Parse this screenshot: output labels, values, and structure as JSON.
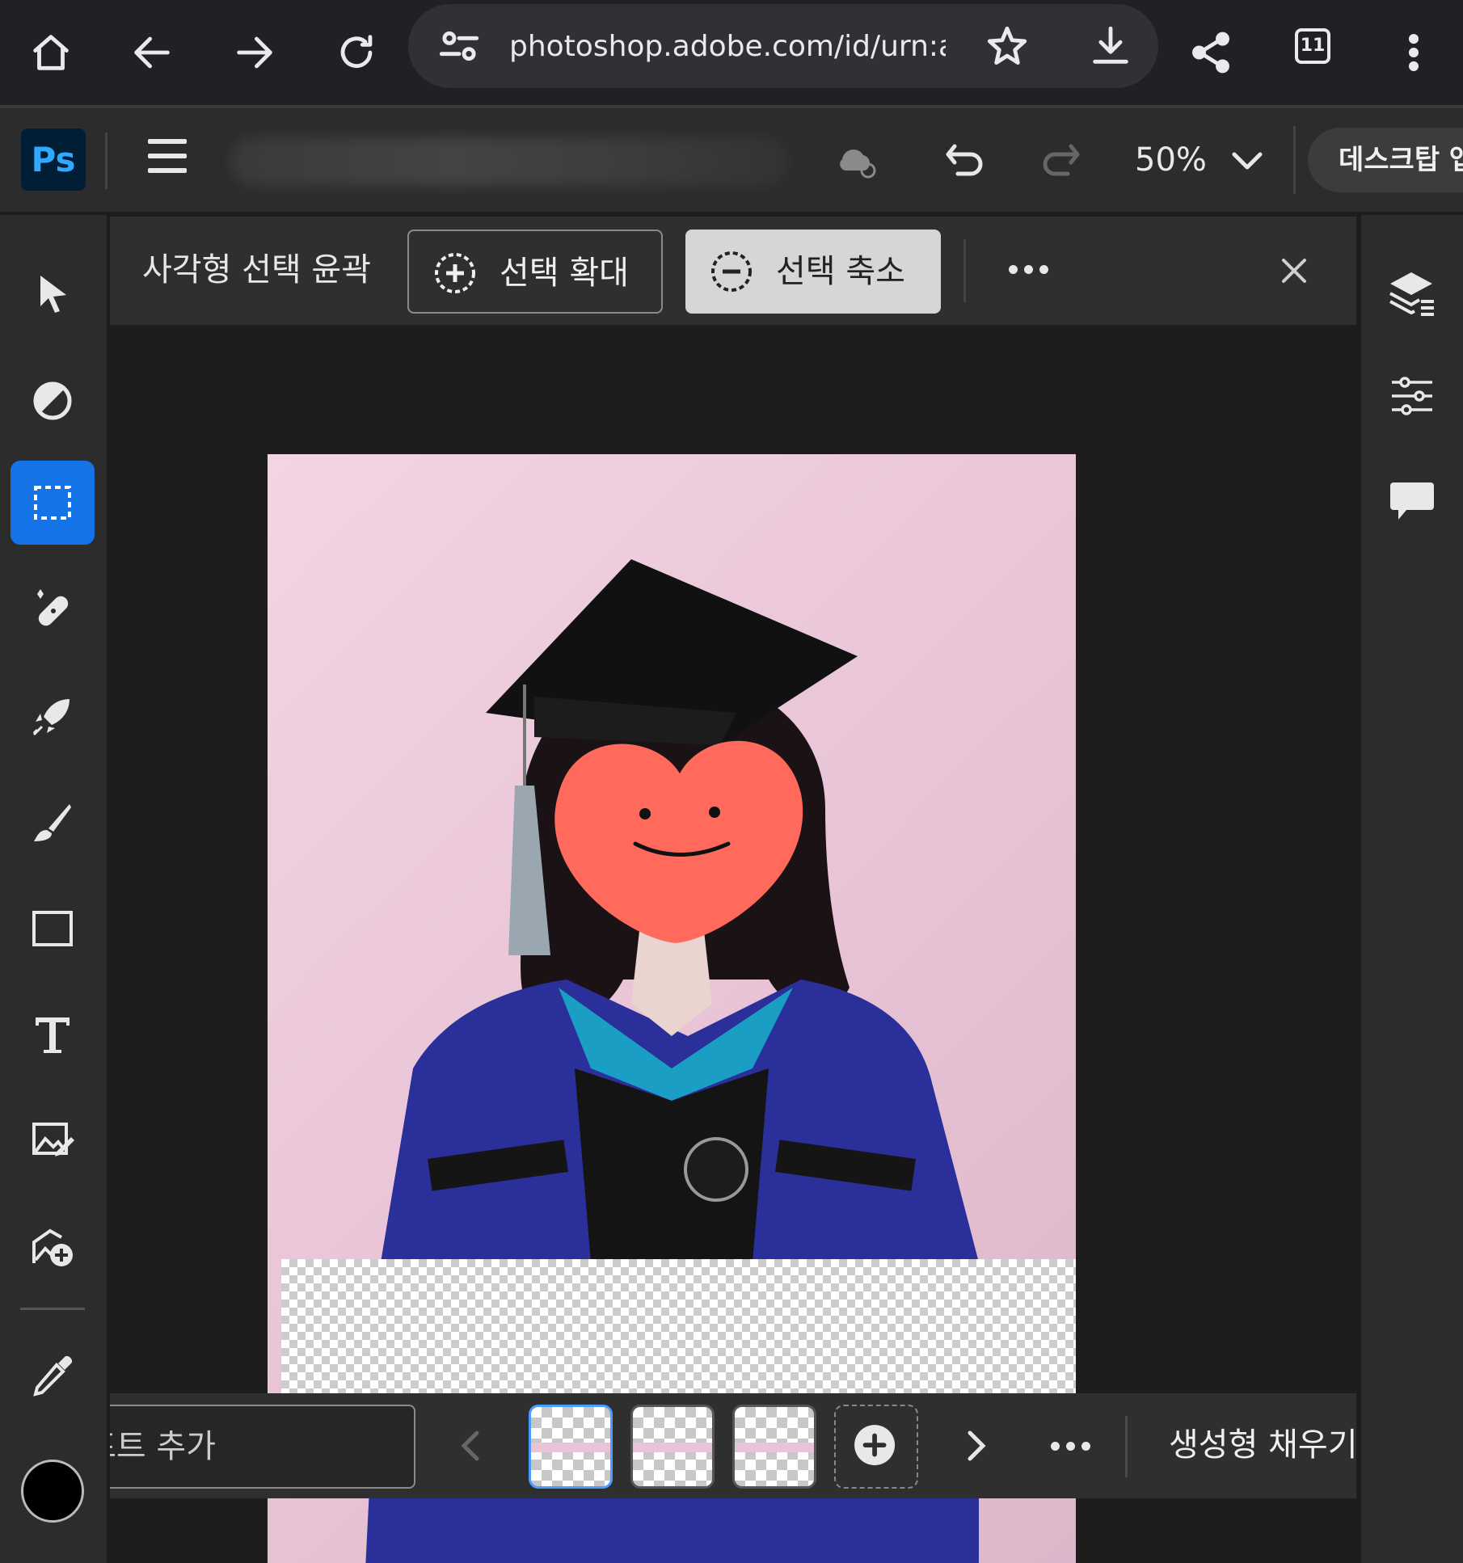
{
  "browser": {
    "url": "photoshop.adobe.com/id/urn:aaid:sc",
    "tab_count": "11"
  },
  "header": {
    "app_logo": "Ps",
    "zoom": "50%",
    "desktop_button": "데스크탑 앱"
  },
  "context_bar": {
    "title": "사각형 선택 윤곽",
    "expand_label": "선택 확대",
    "shrink_label": "선택 축소"
  },
  "generative_bar": {
    "prompt_placeholder": "프롬프트 추가",
    "generate_label": "생성형 채우기"
  },
  "colors": {
    "accent": "#1473e6",
    "foreground_color": "#000000",
    "canvas_background": "#f2d4e3"
  },
  "icons": {
    "browser": [
      "home-icon",
      "back-icon",
      "forward-icon",
      "reload-icon",
      "site-settings-icon",
      "bookmark-star-icon",
      "download-icon",
      "share-icon",
      "tabs-icon",
      "more-vert-icon"
    ],
    "tools": [
      "move-tool-icon",
      "adjust-icon",
      "rect-marquee-icon",
      "healing-icon",
      "quick-action-icon",
      "brush-icon",
      "shape-icon",
      "type-icon",
      "place-image-icon",
      "add-image-icon",
      "eyedropper-icon"
    ],
    "right_panel": [
      "layers-icon",
      "adjustments-icon",
      "comments-icon"
    ]
  }
}
